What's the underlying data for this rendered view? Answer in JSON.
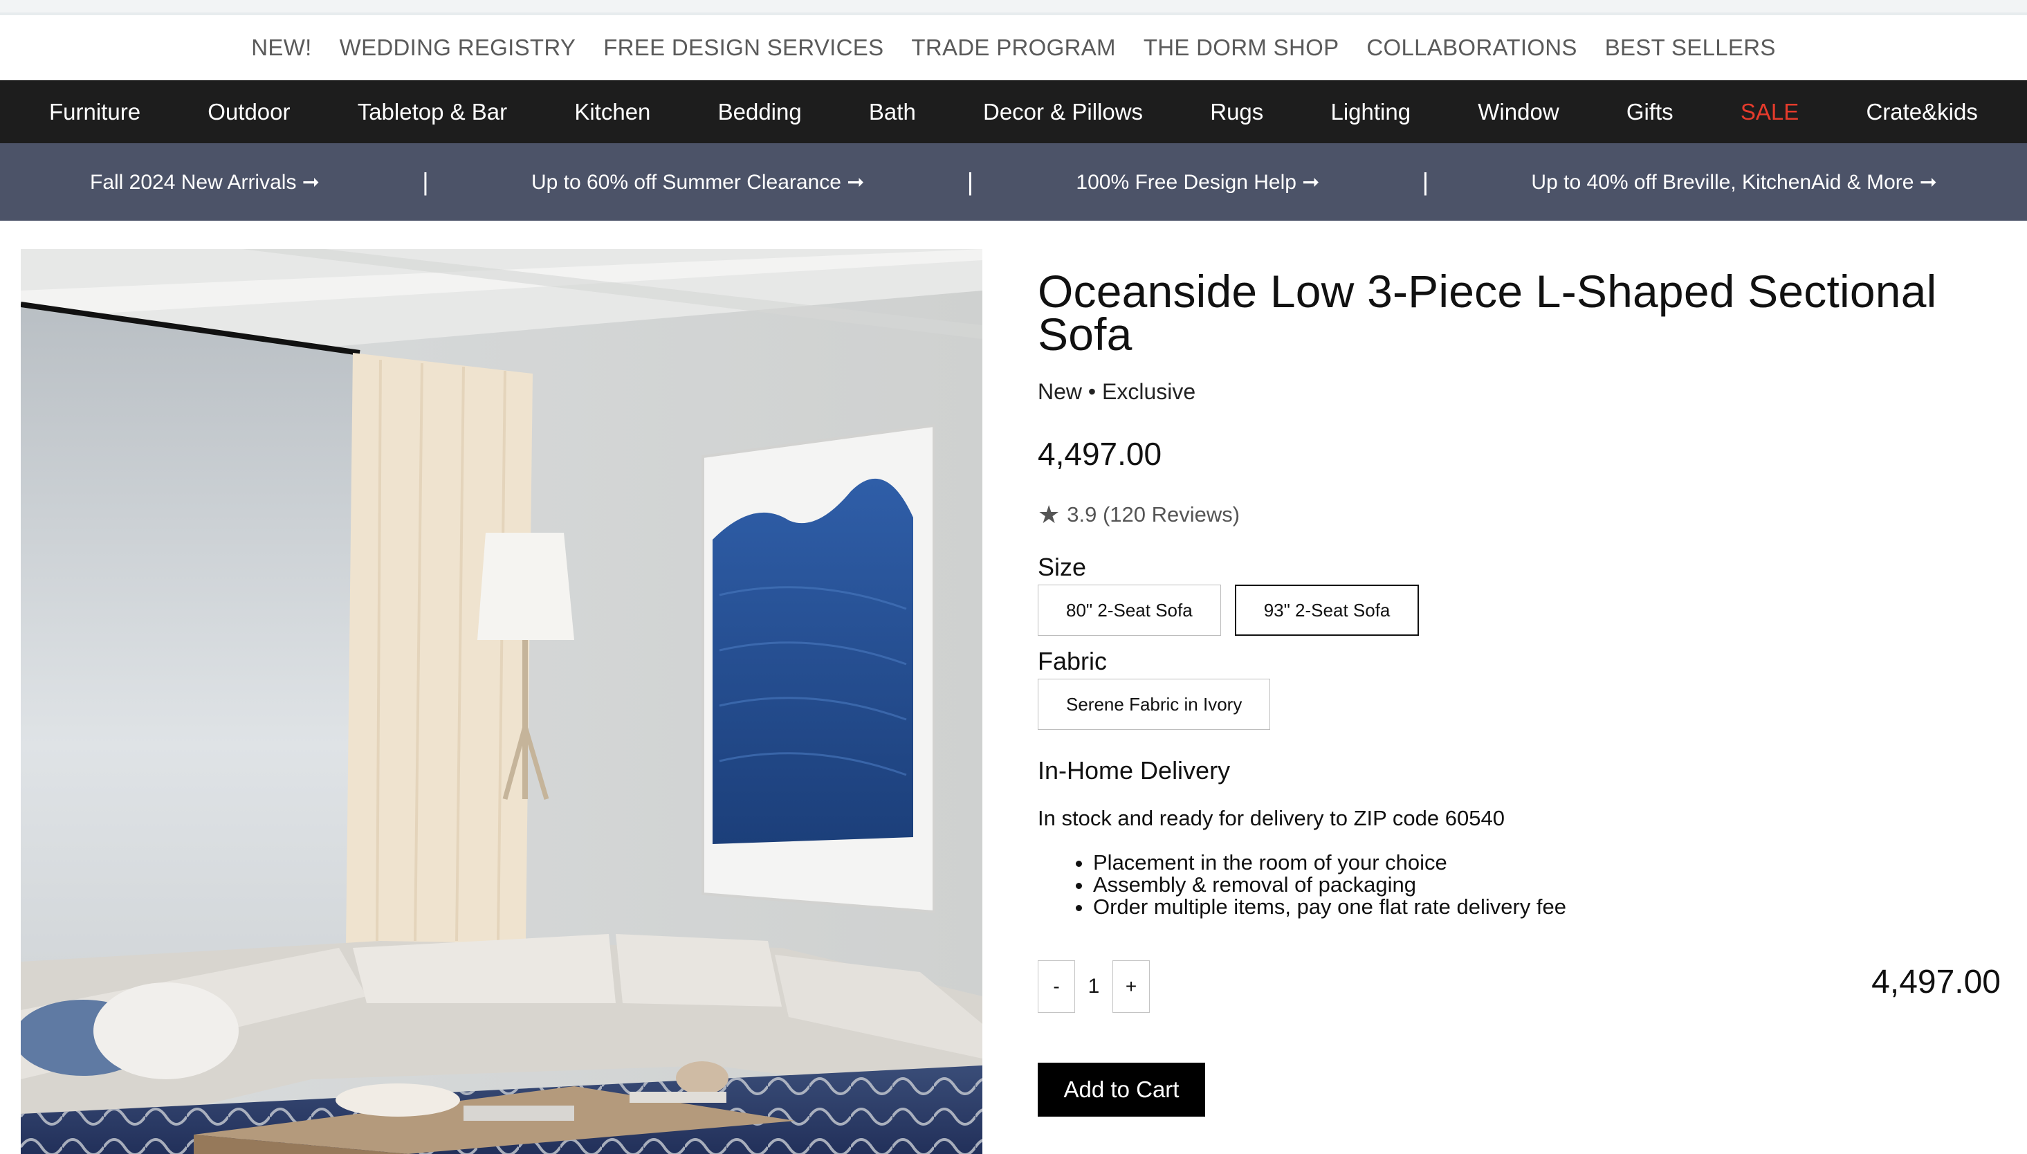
{
  "util_nav": [
    "NEW!",
    "WEDDING REGISTRY",
    "FREE DESIGN SERVICES",
    "TRADE PROGRAM",
    "THE DORM SHOP",
    "COLLABORATIONS",
    "BEST SELLERS"
  ],
  "main_nav": [
    "Furniture",
    "Outdoor",
    "Tabletop & Bar",
    "Kitchen",
    "Bedding",
    "Bath",
    "Decor & Pillows",
    "Rugs",
    "Lighting",
    "Window",
    "Gifts",
    "SALE",
    "Crate&kids"
  ],
  "promos": [
    "Fall 2024 New Arrivals ➞",
    "Up to 60% off Summer Clearance ➞",
    "100% Free Design Help ➞",
    "Up to 40% off Breville, KitchenAid & More ➞"
  ],
  "promo_separator": "|",
  "product": {
    "title": "Oceanside Low 3-Piece L-Shaped Sectional Sofa",
    "tags": "New • Exclusive",
    "price": "4,497.00",
    "rating_star": "★",
    "rating": "3.9 (120 Reviews)",
    "size_label": "Size",
    "sizes": [
      "80\" 2-Seat Sofa",
      "93\" 2-Seat Sofa"
    ],
    "selected_size_index": 1,
    "fabric_label": "Fabric",
    "fabrics": [
      "Serene Fabric in Ivory"
    ],
    "delivery_heading": "In-Home Delivery",
    "delivery_text": "In stock and ready for delivery to ZIP code 60540",
    "delivery_bullets": [
      "Placement in the room of your choice",
      "Assembly & removal of packaging",
      "Order multiple items, pay one flat rate delivery fee"
    ],
    "qty_minus": "-",
    "quantity": "1",
    "qty_plus": "+",
    "line_total": "4,497.00",
    "add_to_cart": "Add to Cart"
  },
  "colors": {
    "main_nav_bg": "#1d1d1d",
    "promo_bar_bg": "#4c5368",
    "sale_red": "#e53b2c",
    "cart_button": "#000000"
  }
}
